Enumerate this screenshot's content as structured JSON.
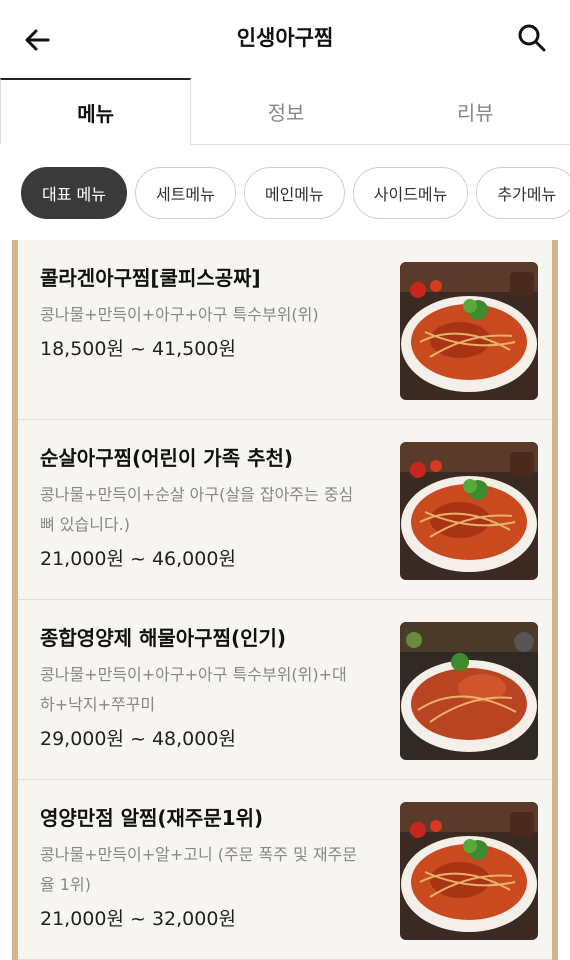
{
  "header": {
    "title": "인생아구찜",
    "back_icon": "back-arrow-icon",
    "search_icon": "search-icon"
  },
  "tabs": [
    {
      "label": "메뉴",
      "active": true
    },
    {
      "label": "정보",
      "active": false
    },
    {
      "label": "리뷰",
      "active": false
    }
  ],
  "chips": [
    {
      "label": "대표 메뉴",
      "active": true
    },
    {
      "label": "세트메뉴",
      "active": false
    },
    {
      "label": "메인메뉴",
      "active": false
    },
    {
      "label": "사이드메뉴",
      "active": false
    },
    {
      "label": "추가메뉴",
      "active": false
    }
  ],
  "menu": [
    {
      "name": "콜라겐아구찜[쿨피스공짜]",
      "desc": "콩나물+만득이+아구+아구 특수부위(위)",
      "price": "18,500원 ~ 41,500원"
    },
    {
      "name": "순살아구찜(어린이 가족 추천)",
      "desc": "콩나물+만득이+순살 아구(살을 잡아주는 중심 뼈 있습니다.)",
      "price": "21,000원 ~ 46,000원"
    },
    {
      "name": "종합영양제 해물아구찜(인기)",
      "desc": "콩나물+만득이+아구+아구 특수부위(위)+대하+낙지+쭈꾸미",
      "price": "29,000원 ~ 48,000원"
    },
    {
      "name": "영양만점 알찜(재주문1위)",
      "desc": "콩나물+만득이+알+고니 (주문 폭주 및 재주문율 1위)",
      "price": "21,000원 ~ 32,000원"
    }
  ],
  "colors": {
    "accent": "#3a3a3a",
    "frame": "#d8b48a",
    "list_bg": "#f7f5f1"
  }
}
